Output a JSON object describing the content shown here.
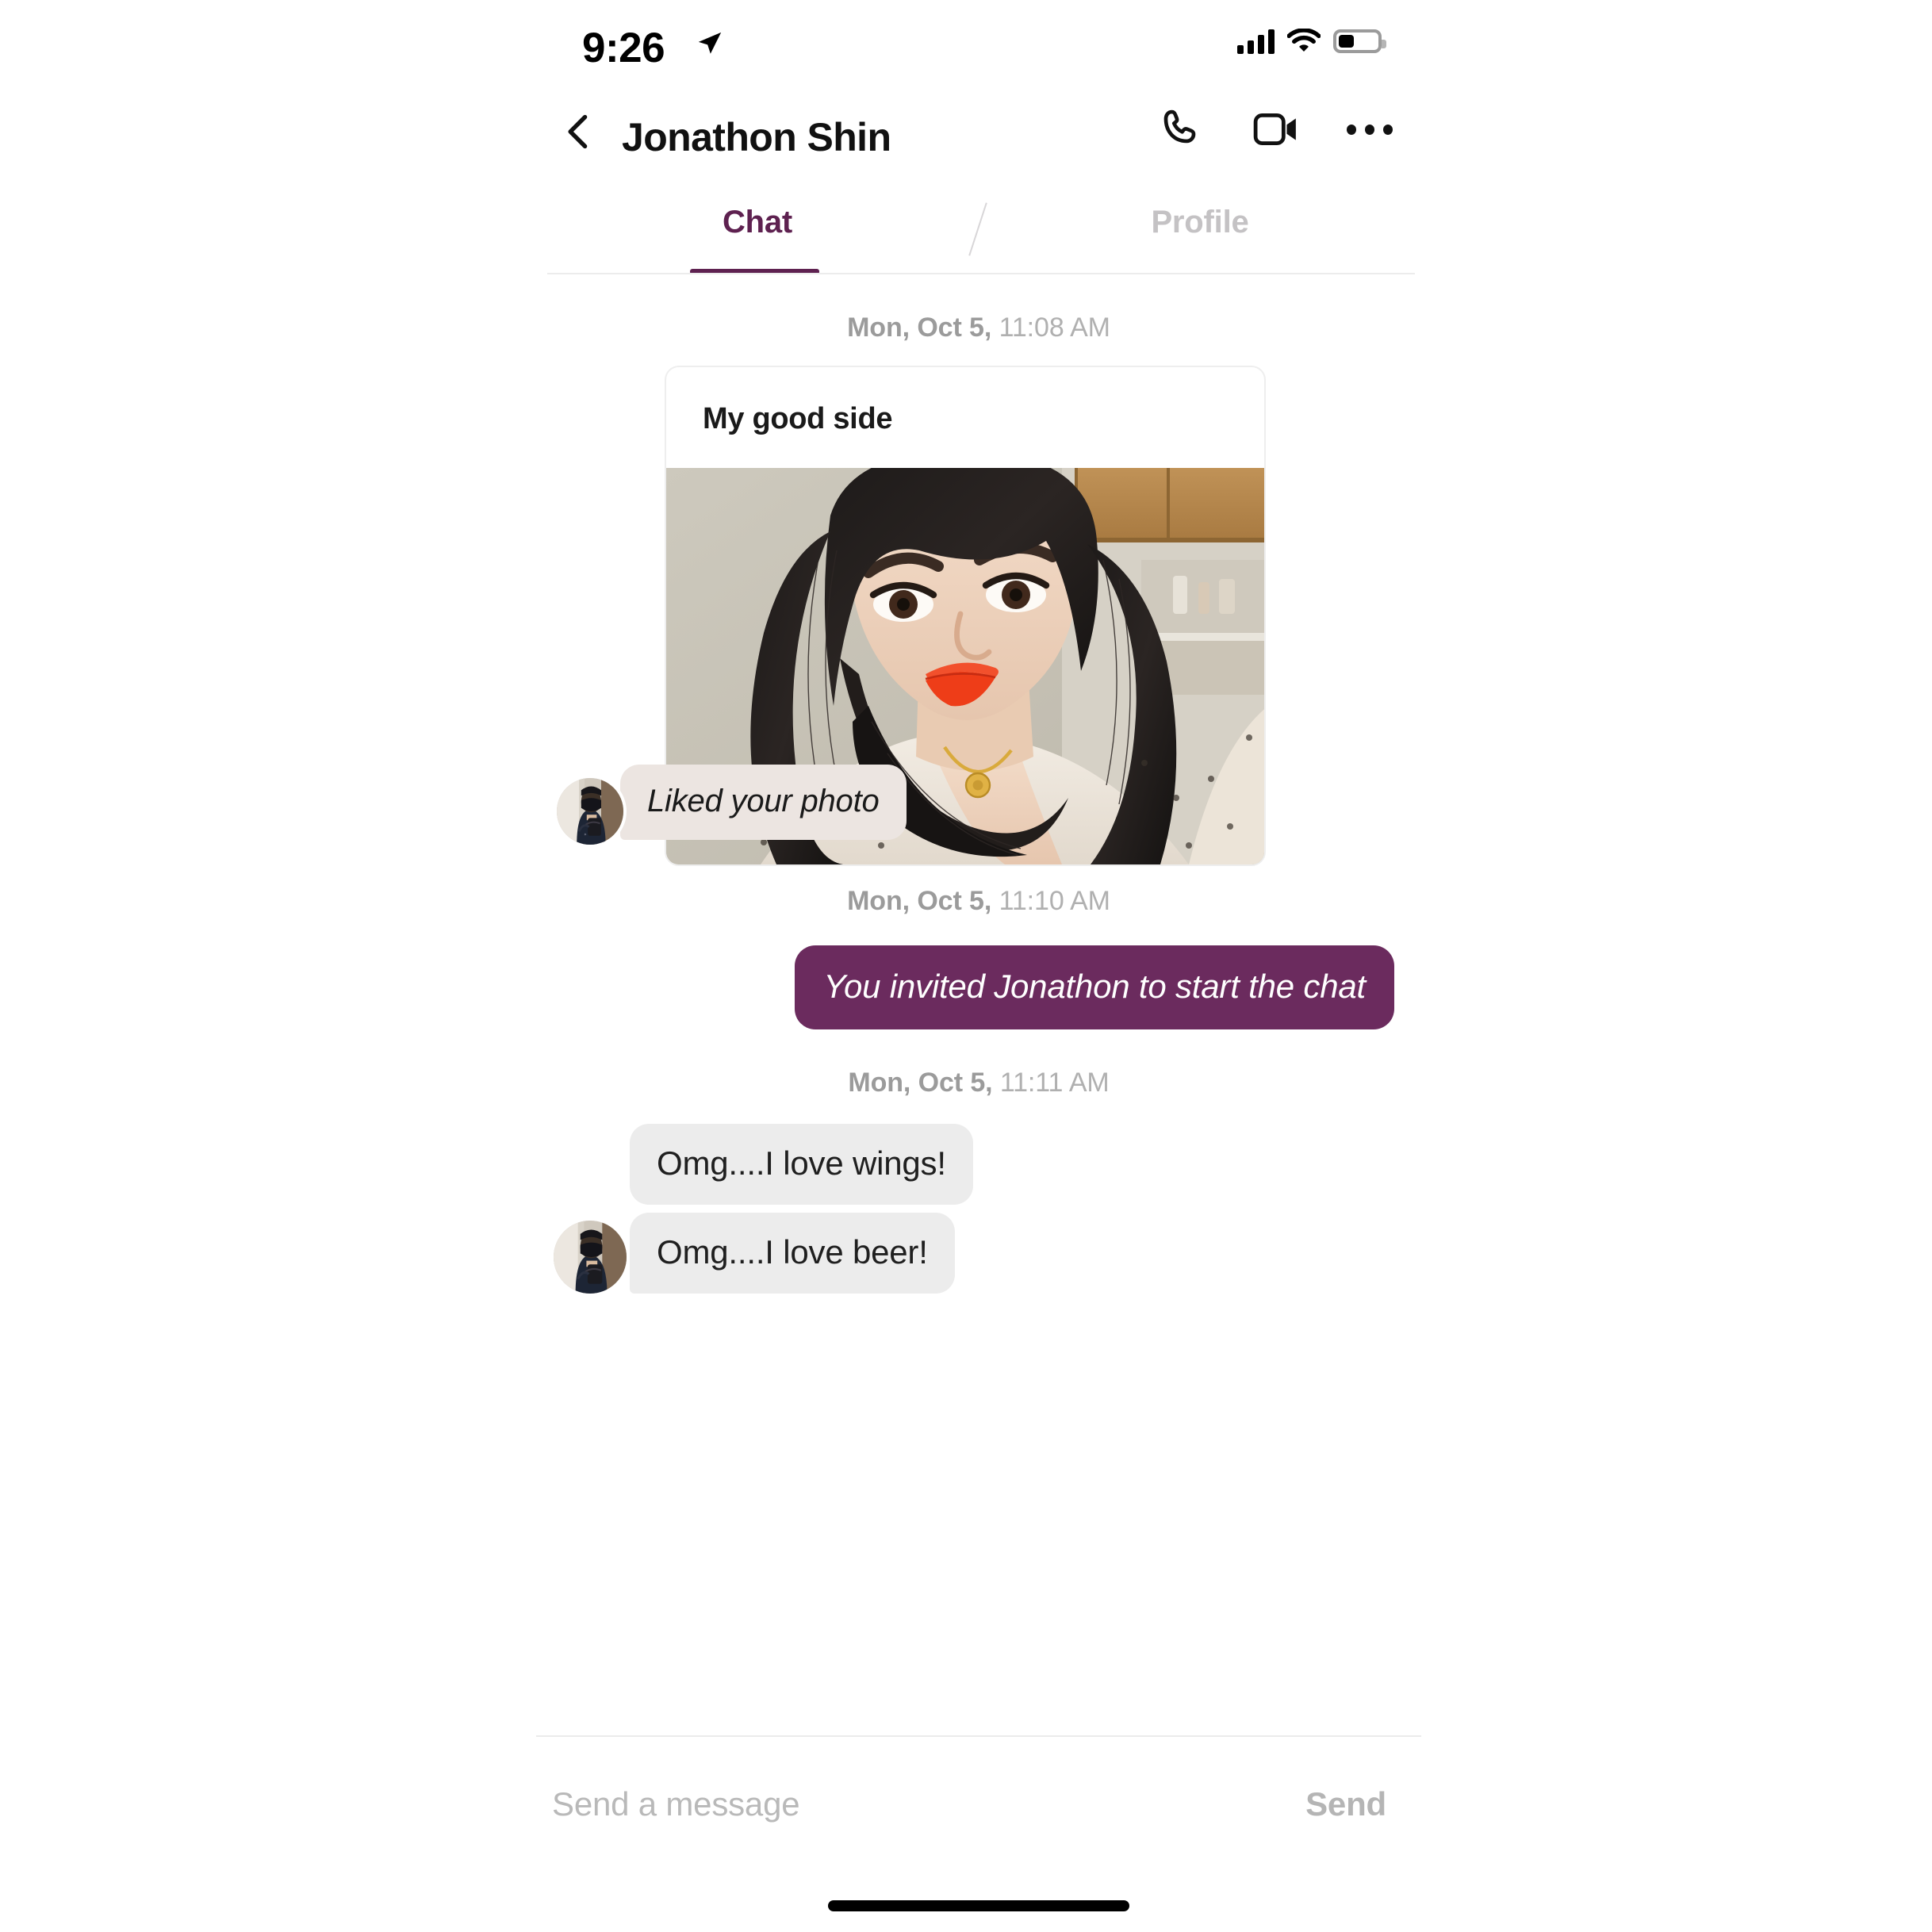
{
  "status_bar": {
    "time": "9:26",
    "location_icon": "location-arrow-icon",
    "signal_icon": "cellular-signal-icon",
    "wifi_icon": "wifi-icon",
    "battery_icon": "battery-icon",
    "battery_level_percent": 35
  },
  "header": {
    "back_icon": "chevron-left-icon",
    "title": "Jonathon Shin",
    "call_icon": "phone-icon",
    "video_icon": "video-camera-icon",
    "overflow_icon": "more-horizontal-icon"
  },
  "tabs": {
    "active_index": 0,
    "items": [
      {
        "label": "Chat"
      },
      {
        "label": "Profile"
      }
    ],
    "active_color": "#5e2150",
    "inactive_color": "#c4c2c4"
  },
  "conversation": {
    "groups": [
      {
        "date": "Mon, Oct 5,",
        "time": " 11:08 AM",
        "photo_card": {
          "caption": "My good side",
          "image_alt": "selfie-photo"
        },
        "reaction": {
          "text": "Liked your photo",
          "avatar_alt": "jonathon-avatar",
          "bubble_color": "#ece5e1"
        }
      },
      {
        "date": "Mon, Oct 5,",
        "time": " 11:10 AM",
        "outgoing": {
          "text": "You invited Jonathon to start the chat",
          "bubble_color": "#6b2b5e"
        }
      },
      {
        "date": "Mon, Oct 5,",
        "time": " 11:11 AM",
        "incoming": [
          {
            "text": "Omg....I love wings!"
          },
          {
            "text": "Omg....I love beer!"
          }
        ],
        "avatar_alt": "jonathon-avatar"
      }
    ]
  },
  "composer": {
    "placeholder": "Send a message",
    "value": "",
    "send_label": "Send"
  }
}
